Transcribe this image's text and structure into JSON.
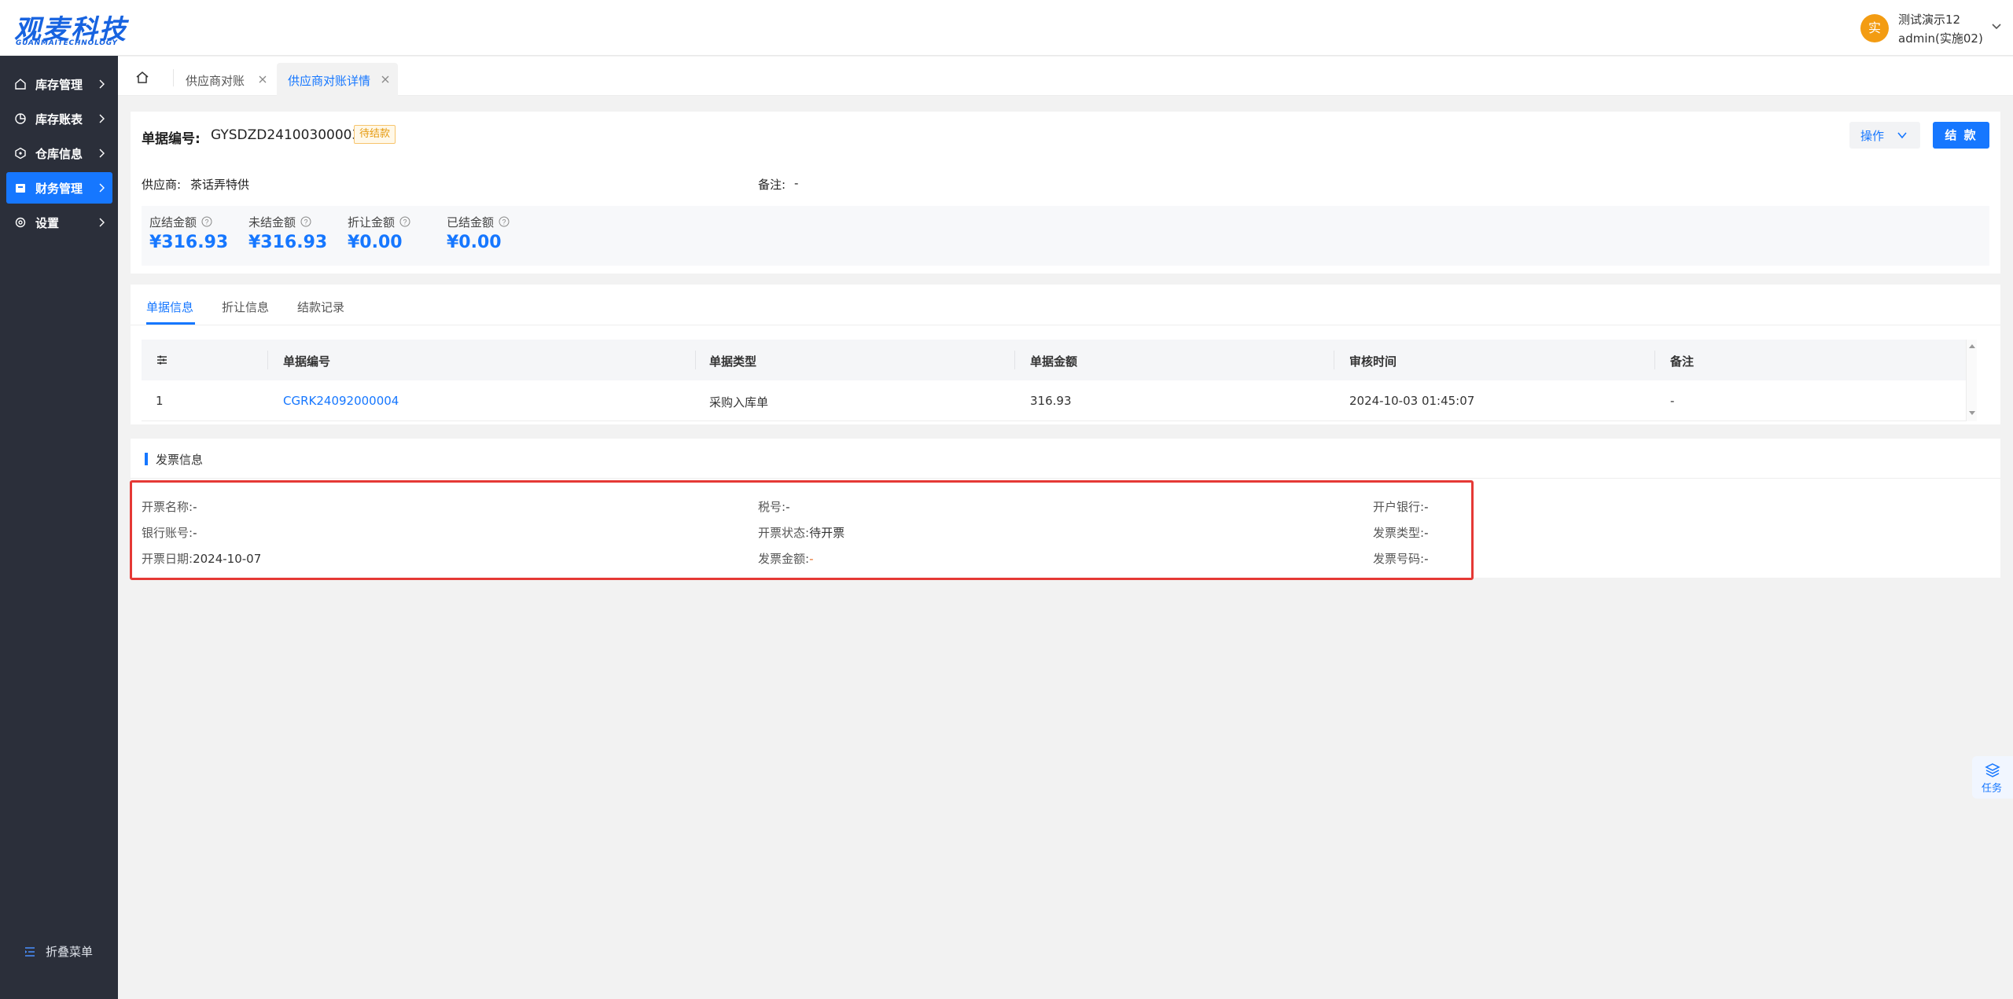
{
  "brand": {
    "name": "观麦科技",
    "sub": "GUANMAITECHNOLOGY",
    "color": "#1763e0"
  },
  "user": {
    "avatar_char": "实",
    "name": "测试演示12",
    "role": "admin(实施02)"
  },
  "sidebar": {
    "items": [
      {
        "label": "库存管理",
        "icon": "home-icon"
      },
      {
        "label": "库存账表",
        "icon": "pie-chart-icon"
      },
      {
        "label": "仓库信息",
        "icon": "box-icon"
      },
      {
        "label": "财务管理",
        "icon": "wallet-icon",
        "active": true
      },
      {
        "label": "设置",
        "icon": "gear-icon"
      }
    ],
    "collapse_label": "折叠菜单"
  },
  "tabs": [
    {
      "label": "供应商对账",
      "active": false
    },
    {
      "label": "供应商对账详情",
      "active": true
    }
  ],
  "detail": {
    "doc_no_label": "单据编号:",
    "doc_no": "GYSDZD24100300003",
    "status": "待结款",
    "op_button": "操作",
    "settle_button": "结 款",
    "supplier_label": "供应商:",
    "supplier": "茶话弄特供",
    "remark_label": "备注:",
    "remark": "-",
    "amounts": [
      {
        "label": "应结金额",
        "value": "¥316.93"
      },
      {
        "label": "未结金额",
        "value": "¥316.93"
      },
      {
        "label": "折让金额",
        "value": "¥0.00"
      },
      {
        "label": "已结金额",
        "value": "¥0.00"
      }
    ]
  },
  "sub_tabs": [
    "单据信息",
    "折让信息",
    "结款记录"
  ],
  "table": {
    "columns": [
      "单据编号",
      "单据类型",
      "单据金额",
      "审核时间",
      "备注"
    ],
    "rows": [
      {
        "index": "1",
        "doc_no": "CGRK24092000004",
        "type": "采购入库单",
        "amount": "316.93",
        "audit_time": "2024-10-03 01:45:07",
        "remark": "-"
      }
    ]
  },
  "invoice": {
    "title": "发票信息",
    "fields": {
      "invoice_name": {
        "label": "开票名称:",
        "value": "-"
      },
      "tax_no": {
        "label": "税号:",
        "value": "-"
      },
      "bank": {
        "label": "开户银行:",
        "value": "-"
      },
      "bank_account": {
        "label": "银行账号:",
        "value": "-"
      },
      "invoice_status": {
        "label": "开票状态:",
        "value": "待开票"
      },
      "invoice_type": {
        "label": "发票类型:",
        "value": "-"
      },
      "invoice_date": {
        "label": "开票日期:",
        "value": "2024-10-07"
      },
      "invoice_amount": {
        "label": "发票金额:",
        "value": "-"
      },
      "invoice_no": {
        "label": "发票号码:",
        "value": "-"
      }
    }
  },
  "task_widget": {
    "label": "任务"
  },
  "colors": {
    "primary": "#1677ff",
    "sidebar_bg": "#2b2f3a",
    "status_orange": "#e59a0e",
    "highlight_red": "#e53935"
  }
}
